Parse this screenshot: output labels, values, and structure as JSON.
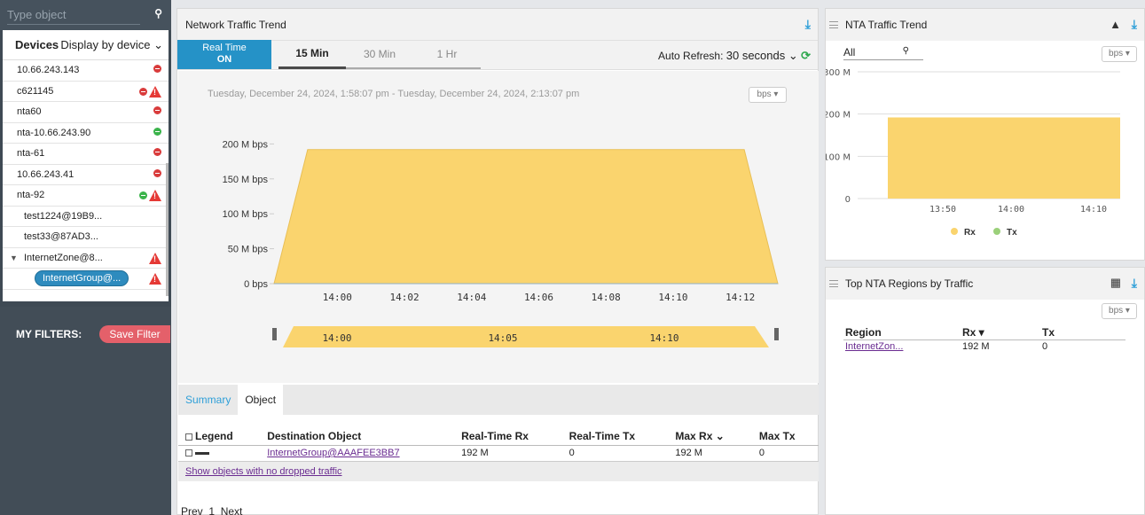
{
  "sidebar": {
    "search_placeholder": "Type object",
    "devices_label": "Devices",
    "display_by": "Display by device ⌄",
    "items": [
      {
        "label": "10.66.243.143"
      },
      {
        "label": "c621145"
      },
      {
        "label": "nta60"
      },
      {
        "label": "nta-10.66.243.90"
      },
      {
        "label": "nta-61"
      },
      {
        "label": "10.66.243.41"
      },
      {
        "label": "nta-92"
      },
      {
        "label": "test1224@19B9..."
      },
      {
        "label": "test33@87AD3..."
      },
      {
        "label": "InternetZone@8..."
      },
      {
        "label": "InternetGroup@..."
      }
    ],
    "filters_label": "MY FILTERS:",
    "save_filter": "Save Filter"
  },
  "center": {
    "title": "Network Traffic Trend",
    "realtime_label": "Real Time",
    "realtime_state": "ON",
    "tabs": [
      "15 Min",
      "30 Min",
      "1 Hr"
    ],
    "auto_refresh_label": "Auto Refresh:",
    "auto_refresh_value": "30 seconds ⌄",
    "time_range": "Tuesday, December 24, 2024, 1:58:07 pm - Tuesday, December 24, 2024, 2:13:07 pm",
    "unit": "bps ▾",
    "bottom_tabs": [
      "Summary",
      "Object"
    ],
    "table": {
      "headers": [
        "Legend",
        "Destination Object",
        "Real-Time Rx",
        "Real-Time Tx",
        "Max Rx",
        "Max Tx"
      ],
      "row": {
        "object": "InternetGroup@AAAFEE3BB7",
        "rt_rx": "192 M",
        "rt_tx": "0",
        "max_rx": "192 M",
        "max_tx": "0"
      }
    },
    "show_note": "Show objects with no dropped traffic",
    "pager": {
      "prev": "Prev",
      "page": "1",
      "next": "Next"
    }
  },
  "chart_data": [
    {
      "type": "area",
      "y_tick_labels": [
        "0 bps",
        "50 M bps",
        "100 M bps",
        "150 M bps",
        "200 M bps"
      ],
      "x_tick_labels": [
        "14:00",
        "14:02",
        "14:04",
        "14:06",
        "14:08",
        "14:10",
        "14:12"
      ],
      "ylim": [
        0,
        250
      ],
      "x": [
        "13:58:07",
        "13:59:07",
        "14:12:07",
        "14:13:07"
      ],
      "series": [
        {
          "values": [
            0,
            192,
            192,
            0
          ]
        }
      ],
      "navigator_labels": [
        "14:00",
        "14:05",
        "14:10"
      ]
    },
    {
      "type": "area",
      "title": "NTA Traffic Trend",
      "y_tick_labels": [
        "0",
        "100 M",
        "200 M",
        "300 M"
      ],
      "x_tick_labels": [
        "13:50",
        "14:00",
        "14:10"
      ],
      "ylim": [
        0,
        300
      ],
      "series": [
        {
          "name": "Rx",
          "values": [
            192
          ]
        },
        {
          "name": "Tx",
          "values": [
            0
          ]
        }
      ],
      "filter_value": "All",
      "unit": "bps ▾"
    }
  ],
  "right_bottom": {
    "title": "Top NTA Regions by Traffic",
    "unit": "bps ▾",
    "headers": [
      "Region",
      "Rx ▾",
      "Tx"
    ],
    "row": {
      "region": "InternetZon...",
      "rx": "192 M",
      "tx": "0"
    }
  },
  "colors": {
    "area_fill": "#fad46e",
    "accent": "#2592c7",
    "rx": "#fad46e",
    "tx": "#9bd07a"
  }
}
